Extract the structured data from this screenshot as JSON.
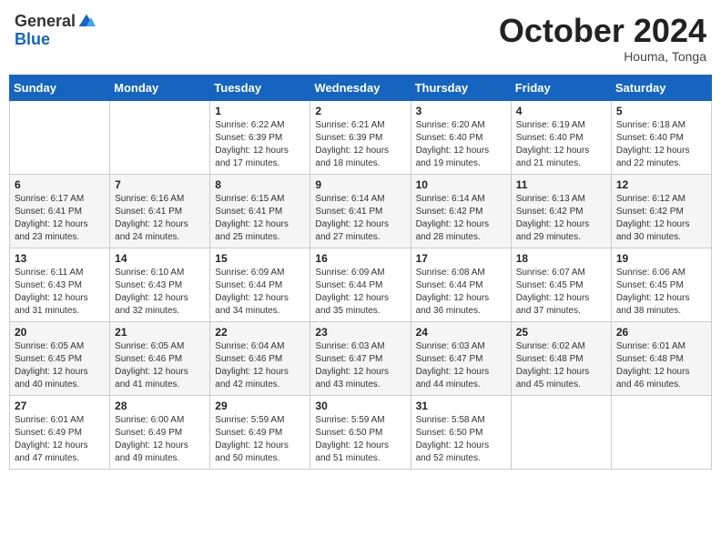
{
  "header": {
    "logo_general": "General",
    "logo_blue": "Blue",
    "month_title": "October 2024",
    "location": "Houma, Tonga"
  },
  "days_of_week": [
    "Sunday",
    "Monday",
    "Tuesday",
    "Wednesday",
    "Thursday",
    "Friday",
    "Saturday"
  ],
  "weeks": [
    [
      {
        "day": "",
        "info": ""
      },
      {
        "day": "",
        "info": ""
      },
      {
        "day": "1",
        "info": "Sunrise: 6:22 AM\nSunset: 6:39 PM\nDaylight: 12 hours and 17 minutes."
      },
      {
        "day": "2",
        "info": "Sunrise: 6:21 AM\nSunset: 6:39 PM\nDaylight: 12 hours and 18 minutes."
      },
      {
        "day": "3",
        "info": "Sunrise: 6:20 AM\nSunset: 6:40 PM\nDaylight: 12 hours and 19 minutes."
      },
      {
        "day": "4",
        "info": "Sunrise: 6:19 AM\nSunset: 6:40 PM\nDaylight: 12 hours and 21 minutes."
      },
      {
        "day": "5",
        "info": "Sunrise: 6:18 AM\nSunset: 6:40 PM\nDaylight: 12 hours and 22 minutes."
      }
    ],
    [
      {
        "day": "6",
        "info": "Sunrise: 6:17 AM\nSunset: 6:41 PM\nDaylight: 12 hours and 23 minutes."
      },
      {
        "day": "7",
        "info": "Sunrise: 6:16 AM\nSunset: 6:41 PM\nDaylight: 12 hours and 24 minutes."
      },
      {
        "day": "8",
        "info": "Sunrise: 6:15 AM\nSunset: 6:41 PM\nDaylight: 12 hours and 25 minutes."
      },
      {
        "day": "9",
        "info": "Sunrise: 6:14 AM\nSunset: 6:41 PM\nDaylight: 12 hours and 27 minutes."
      },
      {
        "day": "10",
        "info": "Sunrise: 6:14 AM\nSunset: 6:42 PM\nDaylight: 12 hours and 28 minutes."
      },
      {
        "day": "11",
        "info": "Sunrise: 6:13 AM\nSunset: 6:42 PM\nDaylight: 12 hours and 29 minutes."
      },
      {
        "day": "12",
        "info": "Sunrise: 6:12 AM\nSunset: 6:42 PM\nDaylight: 12 hours and 30 minutes."
      }
    ],
    [
      {
        "day": "13",
        "info": "Sunrise: 6:11 AM\nSunset: 6:43 PM\nDaylight: 12 hours and 31 minutes."
      },
      {
        "day": "14",
        "info": "Sunrise: 6:10 AM\nSunset: 6:43 PM\nDaylight: 12 hours and 32 minutes."
      },
      {
        "day": "15",
        "info": "Sunrise: 6:09 AM\nSunset: 6:44 PM\nDaylight: 12 hours and 34 minutes."
      },
      {
        "day": "16",
        "info": "Sunrise: 6:09 AM\nSunset: 6:44 PM\nDaylight: 12 hours and 35 minutes."
      },
      {
        "day": "17",
        "info": "Sunrise: 6:08 AM\nSunset: 6:44 PM\nDaylight: 12 hours and 36 minutes."
      },
      {
        "day": "18",
        "info": "Sunrise: 6:07 AM\nSunset: 6:45 PM\nDaylight: 12 hours and 37 minutes."
      },
      {
        "day": "19",
        "info": "Sunrise: 6:06 AM\nSunset: 6:45 PM\nDaylight: 12 hours and 38 minutes."
      }
    ],
    [
      {
        "day": "20",
        "info": "Sunrise: 6:05 AM\nSunset: 6:45 PM\nDaylight: 12 hours and 40 minutes."
      },
      {
        "day": "21",
        "info": "Sunrise: 6:05 AM\nSunset: 6:46 PM\nDaylight: 12 hours and 41 minutes."
      },
      {
        "day": "22",
        "info": "Sunrise: 6:04 AM\nSunset: 6:46 PM\nDaylight: 12 hours and 42 minutes."
      },
      {
        "day": "23",
        "info": "Sunrise: 6:03 AM\nSunset: 6:47 PM\nDaylight: 12 hours and 43 minutes."
      },
      {
        "day": "24",
        "info": "Sunrise: 6:03 AM\nSunset: 6:47 PM\nDaylight: 12 hours and 44 minutes."
      },
      {
        "day": "25",
        "info": "Sunrise: 6:02 AM\nSunset: 6:48 PM\nDaylight: 12 hours and 45 minutes."
      },
      {
        "day": "26",
        "info": "Sunrise: 6:01 AM\nSunset: 6:48 PM\nDaylight: 12 hours and 46 minutes."
      }
    ],
    [
      {
        "day": "27",
        "info": "Sunrise: 6:01 AM\nSunset: 6:49 PM\nDaylight: 12 hours and 47 minutes."
      },
      {
        "day": "28",
        "info": "Sunrise: 6:00 AM\nSunset: 6:49 PM\nDaylight: 12 hours and 49 minutes."
      },
      {
        "day": "29",
        "info": "Sunrise: 5:59 AM\nSunset: 6:49 PM\nDaylight: 12 hours and 50 minutes."
      },
      {
        "day": "30",
        "info": "Sunrise: 5:59 AM\nSunset: 6:50 PM\nDaylight: 12 hours and 51 minutes."
      },
      {
        "day": "31",
        "info": "Sunrise: 5:58 AM\nSunset: 6:50 PM\nDaylight: 12 hours and 52 minutes."
      },
      {
        "day": "",
        "info": ""
      },
      {
        "day": "",
        "info": ""
      }
    ]
  ]
}
